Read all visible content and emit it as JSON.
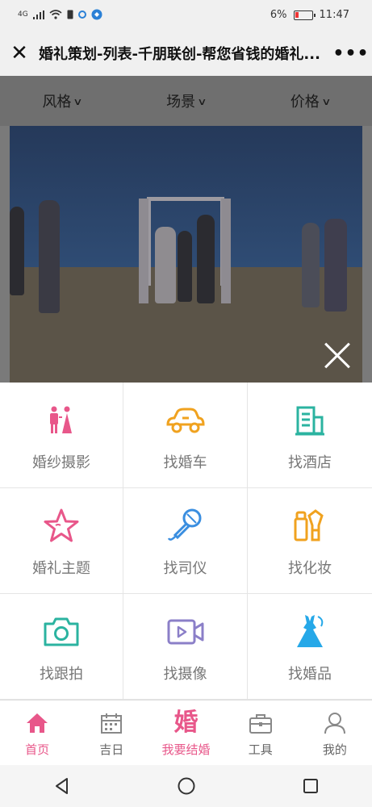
{
  "status": {
    "network": "4G",
    "battery": "6%",
    "time": "11:47"
  },
  "header": {
    "title": "婚礼策划-列表-千朋联创-帮您省钱的婚礼...",
    "more": "•••"
  },
  "filters": [
    {
      "label": "风格"
    },
    {
      "label": "场景"
    },
    {
      "label": "价格"
    }
  ],
  "grid": [
    {
      "label": "婚纱摄影",
      "icon": "couple-icon",
      "color": "#e8578a"
    },
    {
      "label": "找婚车",
      "icon": "car-icon",
      "color": "#f0a21f"
    },
    {
      "label": "找酒店",
      "icon": "hotel-icon",
      "color": "#2bb3a0"
    },
    {
      "label": "婚礼主题",
      "icon": "star-icon",
      "color": "#e8578a"
    },
    {
      "label": "找司仪",
      "icon": "microphone-icon",
      "color": "#3a8ee0"
    },
    {
      "label": "找化妆",
      "icon": "makeup-icon",
      "color": "#f0a21f"
    },
    {
      "label": "找跟拍",
      "icon": "camera-icon",
      "color": "#2bb3a0"
    },
    {
      "label": "找摄像",
      "icon": "video-icon",
      "color": "#8b7fc8"
    },
    {
      "label": "找婚品",
      "icon": "dress-icon",
      "color": "#26a8e8"
    }
  ],
  "tabs": [
    {
      "label": "首页",
      "icon": "home-icon",
      "active": true
    },
    {
      "label": "吉日",
      "icon": "calendar-icon",
      "active": false
    },
    {
      "label": "我要结婚",
      "icon": "marry-icon",
      "char": "婚",
      "active": true
    },
    {
      "label": "工具",
      "icon": "toolbox-icon",
      "active": false
    },
    {
      "label": "我的",
      "icon": "user-icon",
      "active": false
    }
  ],
  "colors": {
    "accent": "#e8578a",
    "overlay": "#7a7a7a"
  }
}
